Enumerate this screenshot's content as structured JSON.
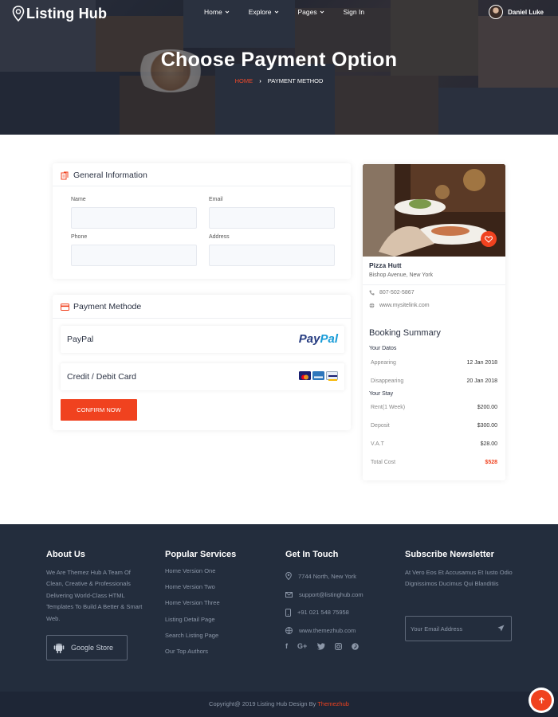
{
  "header": {
    "brand": "Listing Hub",
    "nav": [
      {
        "label": "Home",
        "has_dropdown": true
      },
      {
        "label": "Explore",
        "has_dropdown": true
      },
      {
        "label": "Pages",
        "has_dropdown": true
      },
      {
        "label": "Sign In",
        "has_dropdown": false
      }
    ],
    "user_name": "Daniel Luke"
  },
  "hero": {
    "title": "Choose Payment Option",
    "breadcrumb": {
      "home": "HOME",
      "separator": "›",
      "current": "PAYMENT METHOD"
    }
  },
  "general_info": {
    "title": "General Information",
    "icon": "document-icon",
    "fields": {
      "name": {
        "label": "Name",
        "value": ""
      },
      "email": {
        "label": "Email",
        "value": ""
      },
      "phone": {
        "label": "Phone",
        "value": ""
      },
      "address": {
        "label": "Address",
        "value": ""
      }
    }
  },
  "payment": {
    "title": "Payment Methode",
    "icon": "credit-card-icon",
    "options": [
      {
        "label": "PayPal",
        "logo_text_a": "Pay",
        "logo_text_b": "Pal"
      },
      {
        "label": "Credit / Debit Card",
        "card_icons": [
          "mastercard-icon",
          "amex-icon",
          "visa-icon"
        ]
      }
    ],
    "confirm_label": "CONFIRM NOW"
  },
  "listing": {
    "name": "Pizza Hutt",
    "address": "Bishop Avenue, New York",
    "phone": "807-502-5867",
    "website": "www.mysitelink.com"
  },
  "booking": {
    "title": "Booking Summary",
    "dates_title": "Your Datos",
    "dates": [
      {
        "label": "Appearing",
        "value": "12 Jan 2018"
      },
      {
        "label": "Disappearing",
        "value": "20 Jan 2018"
      }
    ],
    "stay_title": "Your Stay",
    "stay": [
      {
        "label": "Rent(1 Week)",
        "value": "$200.00"
      },
      {
        "label": "Deposit",
        "value": "$300.00"
      },
      {
        "label": "V.A.T",
        "value": "$28.00"
      },
      {
        "label": "Total Cost",
        "value": "$528"
      }
    ]
  },
  "footer": {
    "about": {
      "title": "About Us",
      "text": "We Are Themez Hub A Team Of Clean, Creative & Professionals Delivering World-Class HTML Templates To Build A Better & Smart Web.",
      "store_label": "Google Store"
    },
    "services": {
      "title": "Popular Services",
      "links": [
        "Home Version One",
        "Home Version Two",
        "Home Version Three",
        "Listing Detail Page",
        "Search Listing Page",
        "Our Top Authors"
      ]
    },
    "contact": {
      "title": "Get In Touch",
      "address": "7744 North, New York",
      "email": "support@listinghub.com",
      "phone": "+91 021 548 75958",
      "web": "www.themezhub.com",
      "social": [
        "f",
        "G+",
        "twitter-icon",
        "instagram-icon",
        "pinterest-icon"
      ]
    },
    "newsletter": {
      "title": "Subscribe Newsletter",
      "text": "At Vero Eos Et Accusamus Et Iusto Odio Dignissimos Ducimus Qui Blanditiis",
      "placeholder": "Your Email Address"
    },
    "copyright_prefix": "Copyright@ 2019 Listing Hub Design By",
    "copyright_brand": "Themezhub"
  },
  "colors": {
    "accent": "#f0421f",
    "footer_bg": "#232d3d",
    "text_dark": "#2a3142"
  }
}
